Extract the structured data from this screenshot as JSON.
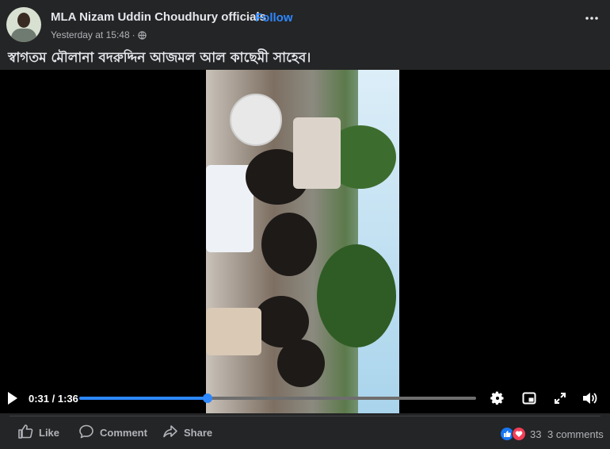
{
  "post": {
    "page_name": "MLA Nizam Uddin Choudhury officials",
    "separator": "·",
    "follow_label": "Follow",
    "timestamp": "Yesterday at 15:48",
    "timestamp_sep": "·",
    "caption": "স্বাগতম মৌলানা বদরুদ্দিন আজমল আল কাছেমী সাহেব।"
  },
  "player": {
    "current_time": "0:31",
    "duration": "1:36",
    "time_display": "0:31 / 1:36",
    "progress_fraction": 0.323,
    "accent_color": "#2d88ff",
    "icons": [
      "play-icon",
      "settings-gear-icon",
      "mini-player-icon",
      "fullscreen-icon",
      "volume-icon"
    ]
  },
  "actions": {
    "like_label": "Like",
    "comment_label": "Comment",
    "share_label": "Share",
    "reaction_count": "33",
    "comments_label": "3 comments",
    "reaction_icons": [
      "like-reaction-icon",
      "love-reaction-icon"
    ]
  },
  "colors": {
    "background": "#242526",
    "link": "#2d88ff",
    "secondary_text": "#b0b3b8"
  }
}
